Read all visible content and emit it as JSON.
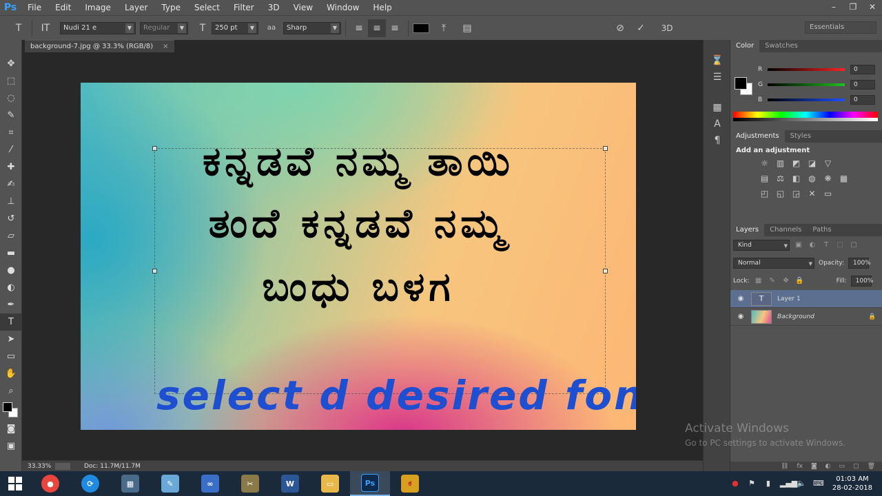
{
  "app": {
    "logo": "Ps"
  },
  "menu": [
    "File",
    "Edit",
    "Image",
    "Layer",
    "Type",
    "Select",
    "Filter",
    "3D",
    "View",
    "Window",
    "Help"
  ],
  "window_controls": {
    "minimize": "–",
    "restore": "❐",
    "close": "✕"
  },
  "options": {
    "tool_icon": "T",
    "orient_icon": "IT",
    "font_family": "Nudi 21 e",
    "font_style": "Regular",
    "size_icon": "T",
    "font_size": "250 pt",
    "aa_icon": "aa",
    "antialias": "Sharp",
    "text_color": "#000000",
    "cancel_icon": "⊘",
    "commit_icon": "✓",
    "three_d": "3D",
    "workspace": "Essentials"
  },
  "document": {
    "tab_title": "background-7.jpg @ 33.3% (RGB/8)",
    "tab_close": "×",
    "kannada_lines": [
      "ಕನ್ನಡವೆ ನಮ್ಮ ತಾಯಿ",
      "ತಂದೆ ಕನ್ನಡವೆ ನಮ್ಮ",
      "ಬಂಧು ಬಳಗ"
    ],
    "caption": "select d desired font",
    "caption_color": "#1e4fd0"
  },
  "status": {
    "zoom": "33.33%",
    "doc_info": "Doc: 11.7M/11.7M"
  },
  "color_panel": {
    "tabs": [
      "Color",
      "Swatches"
    ],
    "channels": [
      {
        "label": "R",
        "value": "0",
        "color": "#ff2020"
      },
      {
        "label": "G",
        "value": "0",
        "color": "#20c020"
      },
      {
        "label": "B",
        "value": "0",
        "color": "#2050ff"
      }
    ]
  },
  "adjustments": {
    "tabs": [
      "Adjustments",
      "Styles"
    ],
    "title": "Add an adjustment"
  },
  "layers_panel": {
    "tabs": [
      "Layers",
      "Channels",
      "Paths"
    ],
    "filter": "Kind",
    "blend_mode": "Normal",
    "opacity_label": "Opacity:",
    "opacity": "100%",
    "lock_label": "Lock:",
    "fill_label": "Fill:",
    "fill": "100%",
    "layers": [
      {
        "name": "Layer 1",
        "thumb": "T"
      },
      {
        "name": "Background",
        "lock": "🔒"
      }
    ]
  },
  "watermark": {
    "line1": "Activate Windows",
    "line2": "Go to PC settings to activate Windows."
  },
  "taskbar": {
    "apps": [
      {
        "name": "chrome",
        "glyph": "●",
        "color": "#e8453c"
      },
      {
        "name": "refresh",
        "glyph": "⟳",
        "color": "#1f8ae0"
      },
      {
        "name": "calculator",
        "glyph": "▦",
        "color": "#4a6a8a"
      },
      {
        "name": "notepad",
        "glyph": "✎",
        "color": "#6aa8d8"
      },
      {
        "name": "infinity",
        "glyph": "∞",
        "color": "#3a6fc8"
      },
      {
        "name": "tools",
        "glyph": "✂",
        "color": "#8a7a4a"
      },
      {
        "name": "word",
        "glyph": "W",
        "color": "#2b5797"
      },
      {
        "name": "explorer",
        "glyph": "▭",
        "color": "#e8b84a"
      },
      {
        "name": "photoshop",
        "glyph": "Ps",
        "color": "#0f2a4a"
      },
      {
        "name": "kannada-app",
        "glyph": "ಕ",
        "color": "#d8a020"
      }
    ],
    "time": "01:03 AM",
    "date": "28-02-2018"
  }
}
